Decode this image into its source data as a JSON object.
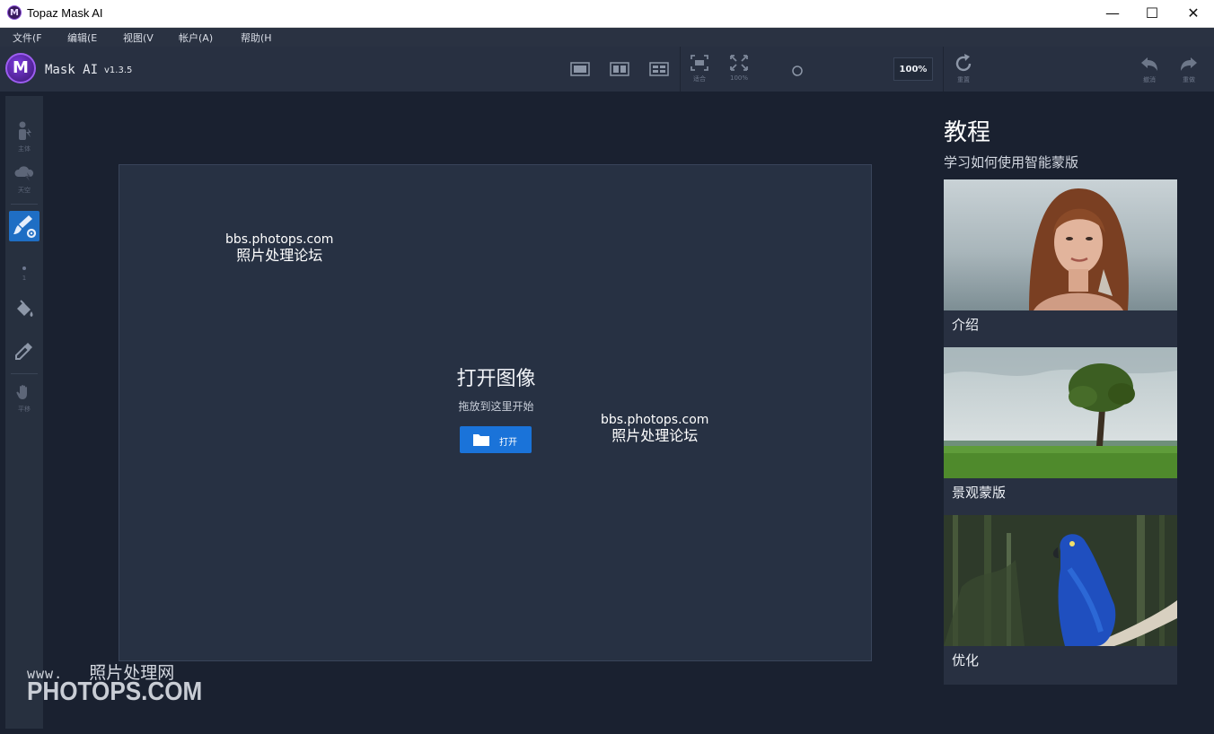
{
  "window": {
    "title": "Topaz Mask AI",
    "controls": {
      "minimize": "—",
      "maximize": "☐",
      "close": "✕"
    }
  },
  "menu": [
    {
      "label": "文件(F"
    },
    {
      "label": "编辑(E"
    },
    {
      "label": "视图(V"
    },
    {
      "label": "帐户(A)"
    },
    {
      "label": "帮助(H"
    }
  ],
  "toolbar": {
    "app_name": "Mask AI",
    "version": "v1.3.5",
    "fit_caption": "适合",
    "full_caption": "100%",
    "zoom_value": "100%",
    "reset_caption": "重置",
    "undo_caption": "撤消",
    "redo_caption": "重做"
  },
  "sidebar": {
    "subject_caption": "主体",
    "sky_caption": "天空",
    "brush_size": "1",
    "pan_caption": "平移"
  },
  "canvas": {
    "title": "打开图像",
    "subtitle": "拖放到这里开始",
    "open_button": "打开"
  },
  "watermarks": {
    "site": "bbs.photops.com",
    "forum": "照片处理论坛",
    "www": "www.",
    "brand_cn": "照片处理网",
    "brand_en": "PHOTOPS.COM"
  },
  "tutorials": {
    "title": "教程",
    "subtitle": "学习如何使用智能蒙版",
    "cards": [
      {
        "label": "介绍"
      },
      {
        "label": "景观蒙版"
      },
      {
        "label": "优化"
      }
    ]
  },
  "colors": {
    "accent": "#1a73d9",
    "background": "#1a2130",
    "panel": "#273143"
  }
}
